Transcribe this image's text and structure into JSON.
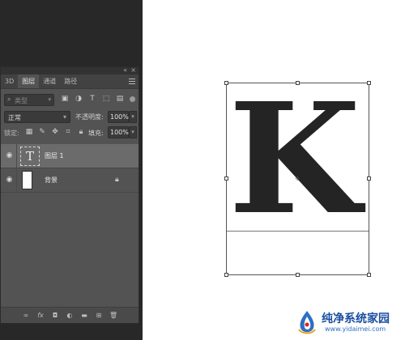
{
  "panel": {
    "tabs": [
      {
        "label": "3D"
      },
      {
        "label": "图层"
      },
      {
        "label": "通道"
      },
      {
        "label": "路径"
      }
    ],
    "filter": {
      "label": "类型"
    },
    "blend_mode": "正常",
    "opacity_label": "不透明度:",
    "opacity_value": "100%",
    "lock_label": "锁定:",
    "fill_label": "填充:",
    "fill_value": "100%",
    "layers": [
      {
        "name": "图层 1",
        "type": "text",
        "thumb": "T",
        "selected": true
      },
      {
        "name": "背景",
        "type": "background",
        "locked": true
      }
    ]
  },
  "canvas": {
    "letter": "K",
    "letter_color": "#242424"
  },
  "watermark": {
    "title": "纯净系统家园",
    "url": "www.yidaimei.com"
  }
}
